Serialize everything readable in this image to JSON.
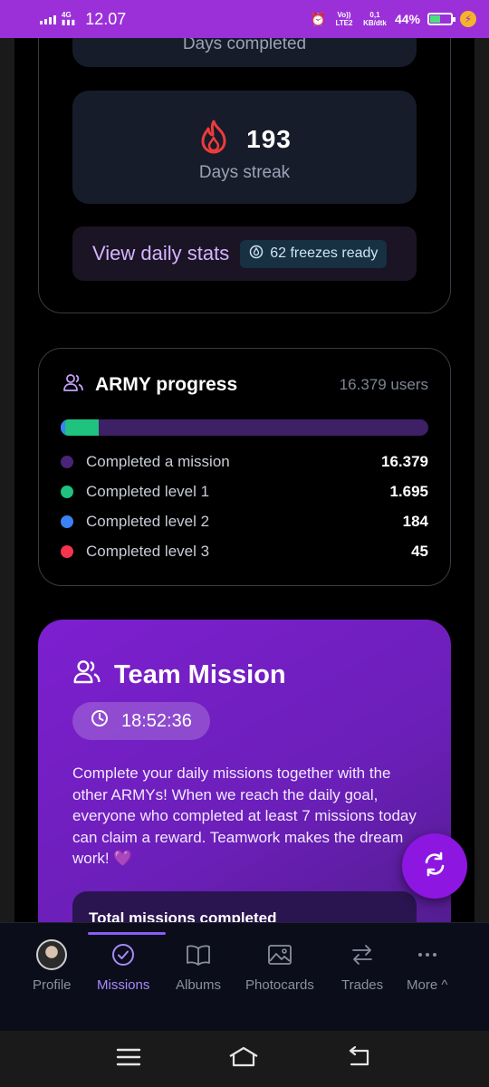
{
  "status_bar": {
    "network": "4G",
    "time": "12.07",
    "volte": "Vo)) LTE2",
    "speed": "0,1 KB/dtk",
    "battery": "44%",
    "battery_level": 0.44
  },
  "stats": {
    "days_completed_label": "Days completed",
    "streak_value": "193",
    "streak_label": "Days streak",
    "daily_link": "View daily stats",
    "freezes": "62 freezes ready"
  },
  "army_progress": {
    "title": "ARMY progress",
    "users": "16.379 users",
    "rows": [
      {
        "label": "Completed a mission",
        "value": "16.379",
        "color": "#4a2478"
      },
      {
        "label": "Completed level 1",
        "value": "1.695",
        "color": "#1fc27e"
      },
      {
        "label": "Completed level 2",
        "value": "184",
        "color": "#3b82f6"
      },
      {
        "label": "Completed level 3",
        "value": "45",
        "color": "#f5344f"
      }
    ],
    "bar": {
      "level1_fraction": 0.1035,
      "level2_fraction": 0.0112
    }
  },
  "team_mission": {
    "title": "Team Mission",
    "timer": "18:52:36",
    "description": "Complete your daily missions together with the other ARMYs! When we reach the daily goal, everyone who completed at least 7 missions today can claim a reward. Teamwork makes the dream work!",
    "heart": "💜",
    "total_label": "Total missions completed"
  },
  "nav": {
    "items": [
      {
        "label": "Profile"
      },
      {
        "label": "Missions"
      },
      {
        "label": "Albums"
      },
      {
        "label": "Photocards"
      },
      {
        "label": "Trades"
      },
      {
        "label": "More ^"
      }
    ]
  },
  "colors": {
    "accent": "#8d16e0",
    "status_bar": "#9b30d9",
    "streak_fire": "#ef3b3b"
  }
}
